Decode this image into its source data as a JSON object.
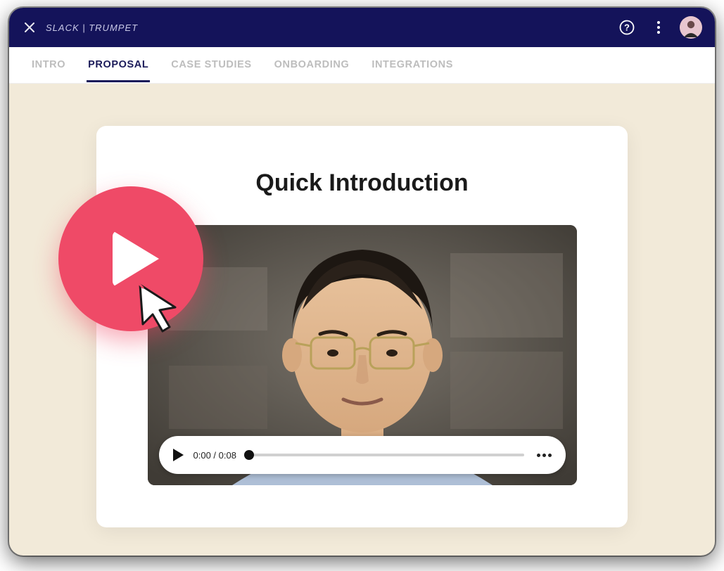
{
  "header": {
    "title": "SLACK | TRUMPET"
  },
  "tabs": [
    {
      "label": "INTRO",
      "active": false
    },
    {
      "label": "PROPOSAL",
      "active": true
    },
    {
      "label": "CASE STUDIES",
      "active": false
    },
    {
      "label": "ONBOARDING",
      "active": false
    },
    {
      "label": "INTEGRATIONS",
      "active": false
    }
  ],
  "card": {
    "heading": "Quick Introduction"
  },
  "video": {
    "current_time": "0:00",
    "duration": "0:08",
    "time_display": "0:00 / 0:08"
  },
  "colors": {
    "header_bg": "#14135a",
    "accent": "#ef4a67",
    "page_bg": "#f2ead9"
  }
}
